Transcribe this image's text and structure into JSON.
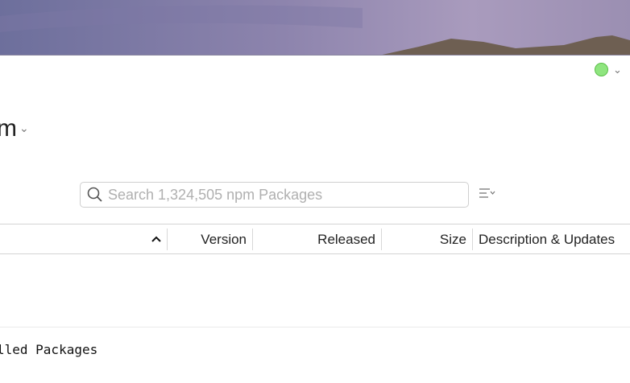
{
  "header": {
    "title_fragment": "m"
  },
  "search": {
    "placeholder": "Search 1,324,505 npm Packages"
  },
  "table": {
    "columns": [
      "Version",
      "Released",
      "Size",
      "Description & Updates"
    ]
  },
  "section": {
    "label_fragment": "lled Packages"
  },
  "colors": {
    "status": "#8fe57f"
  }
}
